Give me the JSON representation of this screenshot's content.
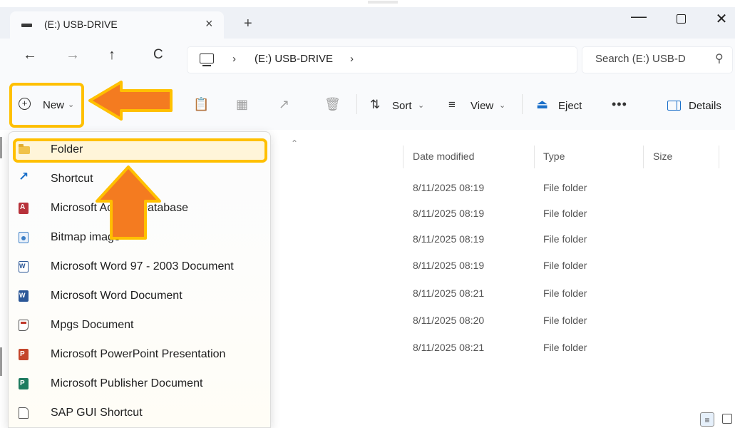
{
  "window": {
    "tab_title": "(E:) USB-DRIVE",
    "tab_close": "×",
    "new_tab": "+",
    "minimize": "—",
    "close": "✕"
  },
  "nav": {
    "back": "←",
    "forward": "→",
    "up": "↑",
    "refresh": "C"
  },
  "address": {
    "separator": "›",
    "location": "(E:) USB-DRIVE"
  },
  "search": {
    "placeholder": "Search (E:) USB-D",
    "icon": "search-icon"
  },
  "toolbar": {
    "new_label": "New",
    "sort_label": "Sort",
    "view_label": "View",
    "eject_label": "Eject",
    "more_label": "•••",
    "details_label": "Details",
    "chevron": "⌄"
  },
  "columns": {
    "date_modified": "Date modified",
    "type": "Type",
    "size": "Size"
  },
  "rows": [
    {
      "date": "8/11/2025 08:19",
      "type": "File folder"
    },
    {
      "date": "8/11/2025 08:19",
      "type": "File folder"
    },
    {
      "date": "8/11/2025 08:19",
      "type": "File folder"
    },
    {
      "date": "8/11/2025 08:19",
      "type": "File folder"
    },
    {
      "date": "8/11/2025 08:21",
      "type": "File folder"
    },
    {
      "date": "8/11/2025 08:20",
      "type": "File folder"
    },
    {
      "date": "8/11/2025 08:21",
      "type": "File folder"
    }
  ],
  "new_menu": {
    "items": [
      {
        "label": "Folder",
        "icon": "folder-icon"
      },
      {
        "label": "Shortcut",
        "icon": "shortcut-icon"
      },
      {
        "label": "Microsoft Access Database",
        "icon": "access-icon"
      },
      {
        "label": "Bitmap image",
        "icon": "bitmap-icon"
      },
      {
        "label": "Microsoft Word 97 - 2003 Document",
        "icon": "word97-icon"
      },
      {
        "label": "Microsoft Word Document",
        "icon": "word-icon"
      },
      {
        "label": "Mpgs Document",
        "icon": "mpgs-icon"
      },
      {
        "label": "Microsoft PowerPoint Presentation",
        "icon": "powerpoint-icon"
      },
      {
        "label": "Microsoft Publisher Document",
        "icon": "publisher-icon"
      },
      {
        "label": "SAP GUI Shortcut",
        "icon": "sap-shortcut-icon"
      }
    ]
  },
  "colors": {
    "highlight": "#ffc000",
    "arrow": "#f47b20",
    "accent": "#1a6fc9"
  }
}
